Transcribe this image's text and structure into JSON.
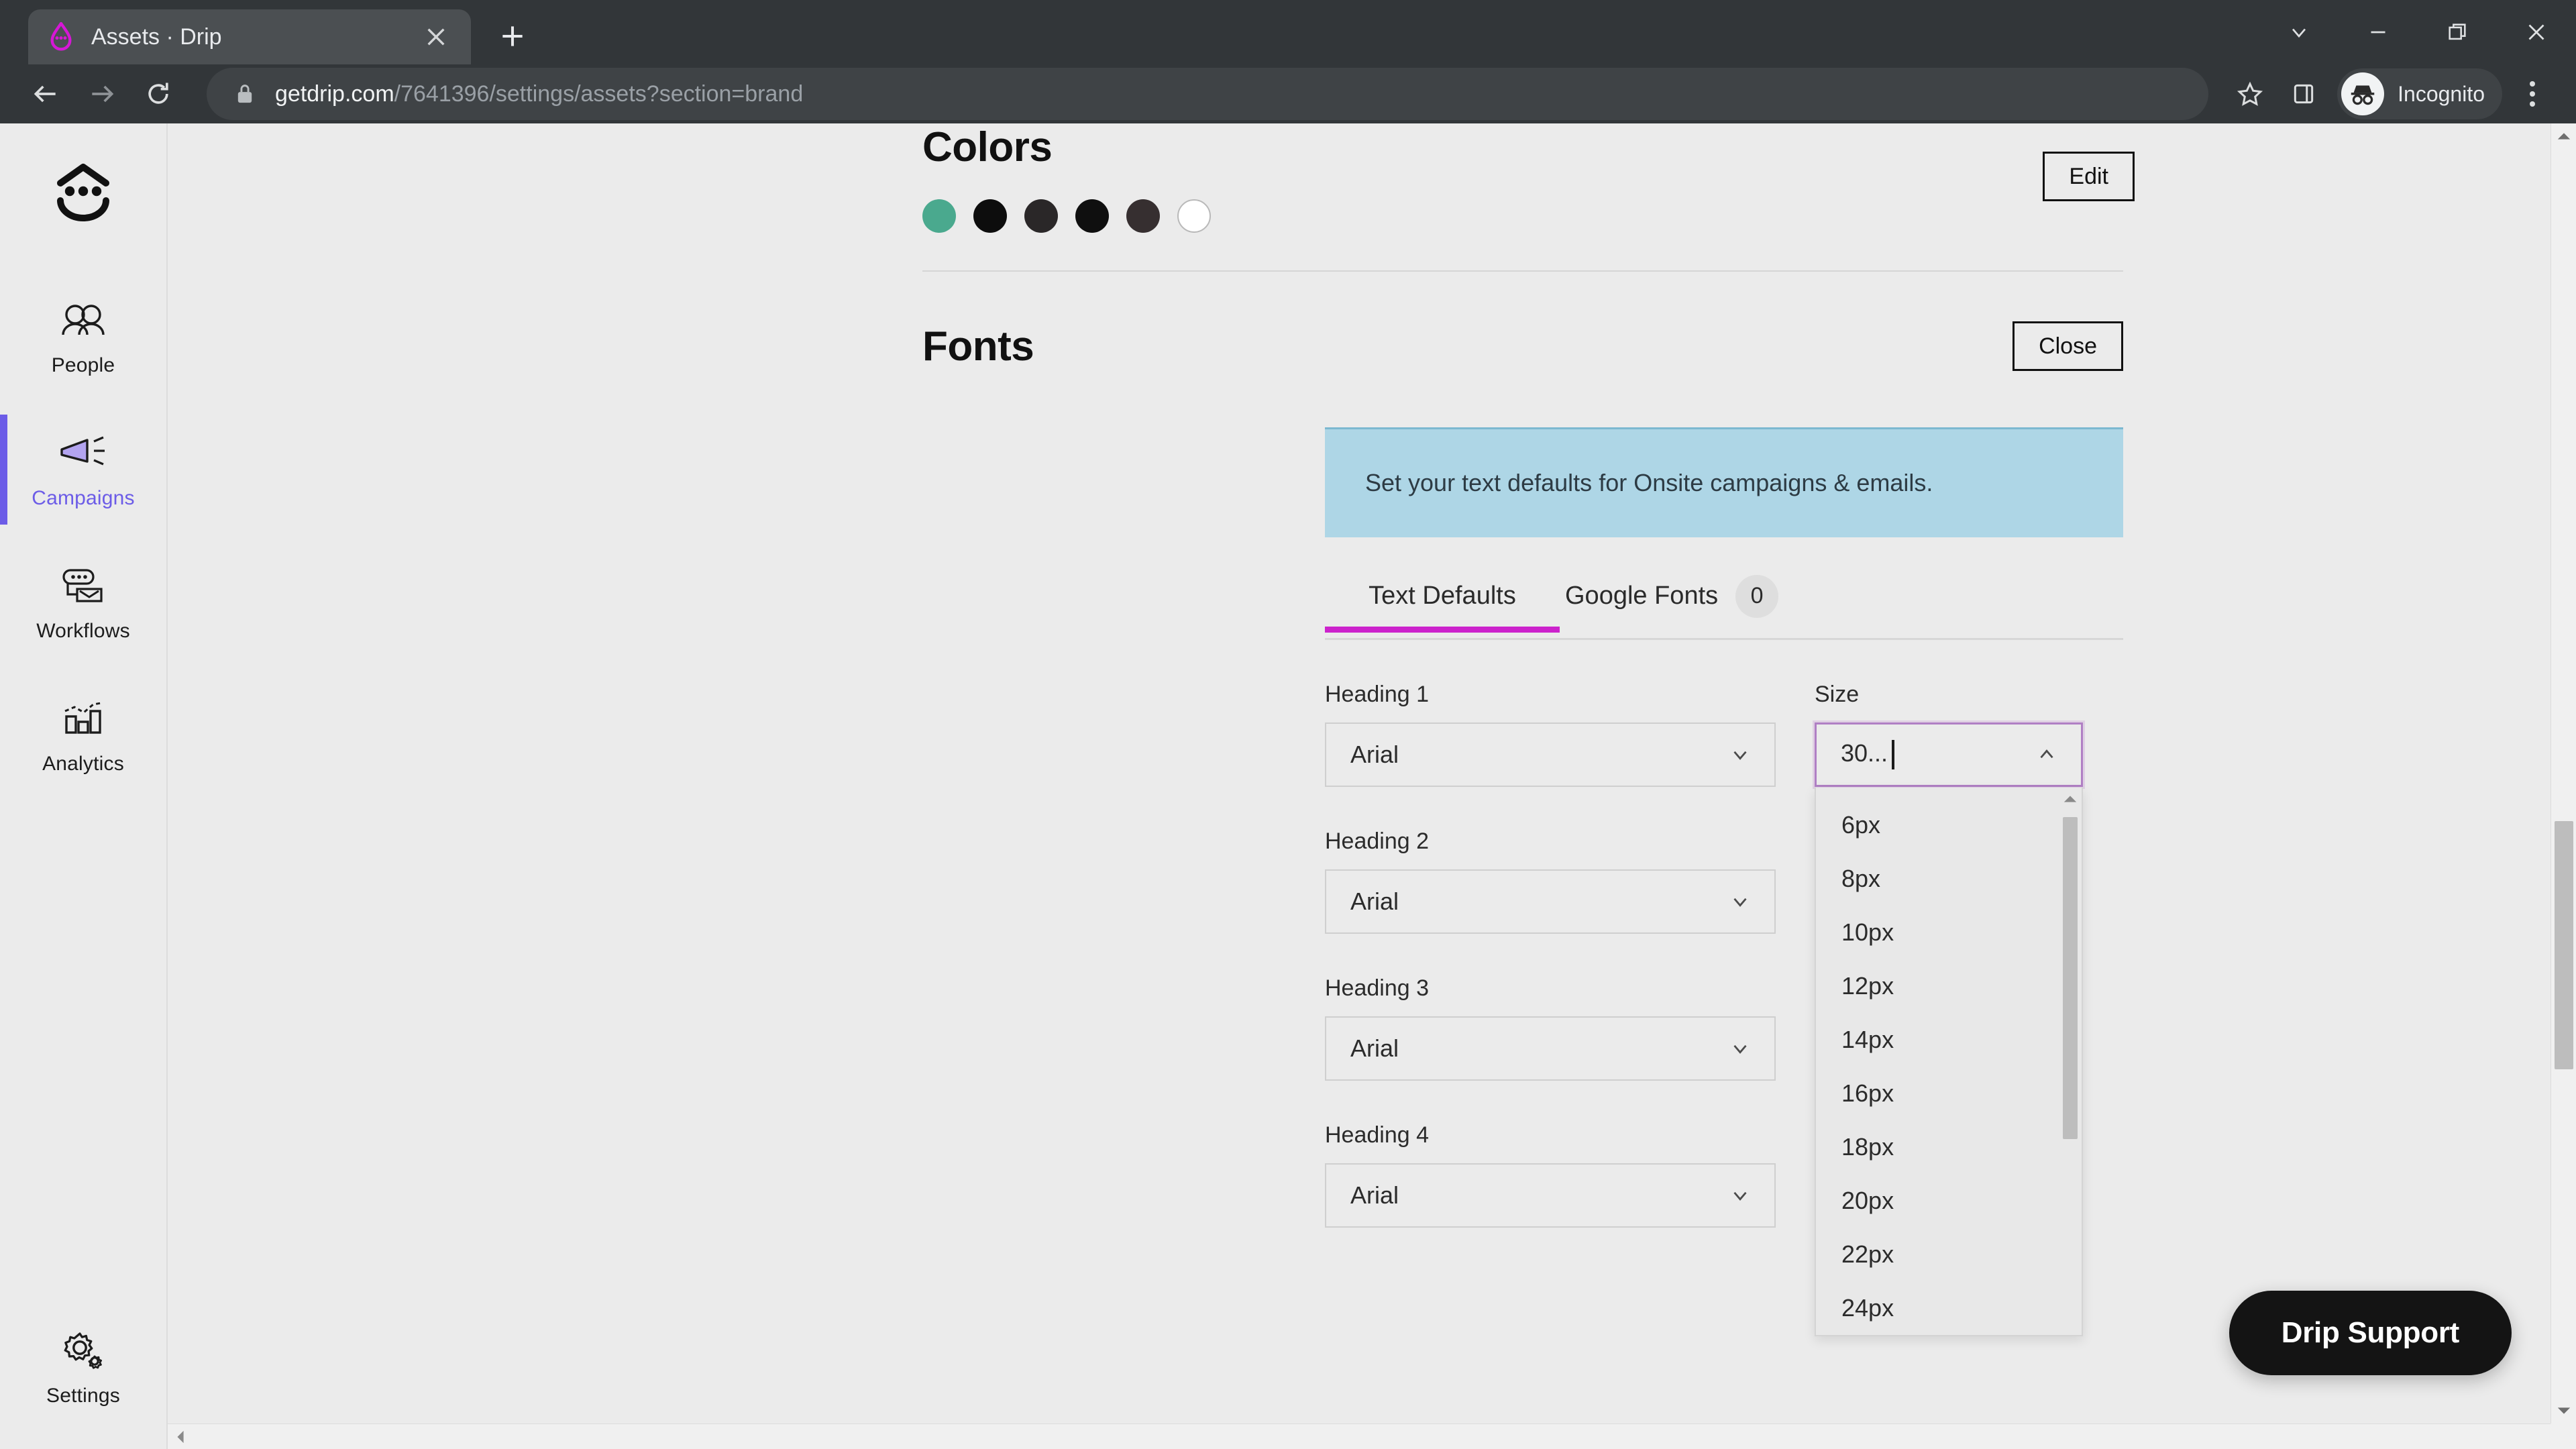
{
  "browser": {
    "tab": {
      "title": "Assets · Drip",
      "favicon": "drip-logo-icon",
      "close": "×"
    },
    "new_tab_label": "+",
    "window_controls": [
      "tab-search-chevron",
      "minimize",
      "restore",
      "close"
    ],
    "url_domain": "getdrip.com",
    "url_path": "/7641396/settings/assets?section=brand",
    "profile_label": "Incognito",
    "toolbar_icons": [
      "back-arrow",
      "forward-arrow",
      "reload",
      "lock",
      "bookmark-star",
      "side-panel",
      "incognito-avatar",
      "three-dot-menu"
    ]
  },
  "sidebar": {
    "logo": "drip-face-logo",
    "items": [
      {
        "label": "People",
        "icon": "people-icon",
        "active": false
      },
      {
        "label": "Campaigns",
        "icon": "megaphone-icon",
        "active": true
      },
      {
        "label": "Workflows",
        "icon": "workflow-icon",
        "active": false
      },
      {
        "label": "Analytics",
        "icon": "bar-chart-icon",
        "active": false
      }
    ],
    "settings": {
      "label": "Settings",
      "icon": "gear-icon"
    },
    "active_color": "#6c5ce7"
  },
  "colors_section": {
    "title": "Colors",
    "edit_label": "Edit",
    "swatches": [
      "#4aa98e",
      "#0d0d0d",
      "#2a2728",
      "#0f0f0f",
      "#362f30",
      "#ffffff"
    ]
  },
  "fonts_section": {
    "title": "Fonts",
    "close_label": "Close",
    "callout": "Set your text defaults for Onsite campaigns & emails.",
    "callout_bg": "#aed6e6",
    "tabs": [
      {
        "label": "Text Defaults",
        "active": true
      },
      {
        "label": "Google Fonts",
        "active": false,
        "badge": "0"
      }
    ],
    "active_tab_color": "#cc22cc",
    "size_column_label": "Size",
    "rows": [
      {
        "label": "Heading 1",
        "font": "Arial"
      },
      {
        "label": "Heading 2",
        "font": "Arial"
      },
      {
        "label": "Heading 3",
        "font": "Arial"
      },
      {
        "label": "Heading 4",
        "font": "Arial"
      }
    ],
    "size_input": {
      "value": "30...",
      "focused": true,
      "chevron": "chevron-up-icon"
    },
    "size_options": [
      "6px",
      "8px",
      "10px",
      "12px",
      "14px",
      "16px",
      "18px",
      "20px",
      "22px",
      "24px"
    ]
  },
  "support": {
    "label": "Drip Support"
  }
}
